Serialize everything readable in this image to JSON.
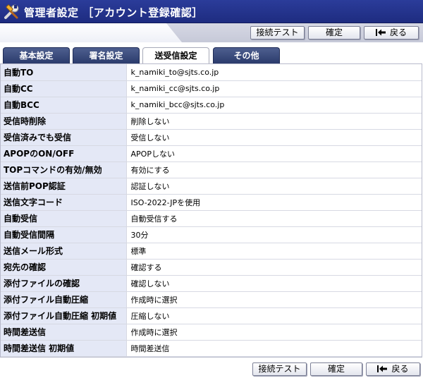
{
  "header": {
    "title": "管理者設定 ［アカウント登録確認］",
    "icon": "tools-icon"
  },
  "buttons": {
    "connection_test": "接続テスト",
    "confirm": "確定",
    "back": "戻る"
  },
  "tabs": [
    {
      "label": "基本設定",
      "active": false
    },
    {
      "label": "署名設定",
      "active": false
    },
    {
      "label": "送受信設定",
      "active": true
    },
    {
      "label": "その他",
      "active": false
    }
  ],
  "rows": [
    {
      "label": "自動TO",
      "value": "k_namiki_to@sjts.co.jp"
    },
    {
      "label": "自動CC",
      "value": "k_namiki_cc@sjts.co.jp"
    },
    {
      "label": "自動BCC",
      "value": "k_namiki_bcc@sjts.co.jp"
    },
    {
      "label": "受信時削除",
      "value": "削除しない"
    },
    {
      "label": "受信済みでも受信",
      "value": "受信しない"
    },
    {
      "label": "APOPのON/OFF",
      "value": "APOPしない"
    },
    {
      "label": "TOPコマンドの有効/無効",
      "value": "有効にする"
    },
    {
      "label": "送信前POP認証",
      "value": "認証しない"
    },
    {
      "label": "送信文字コード",
      "value": "ISO-2022-JPを使用"
    },
    {
      "label": "自動受信",
      "value": "自動受信する"
    },
    {
      "label": "自動受信間隔",
      "value": "30分"
    },
    {
      "label": "送信メール形式",
      "value": "標準"
    },
    {
      "label": "宛先の確認",
      "value": "確認する"
    },
    {
      "label": "添付ファイルの確認",
      "value": "確認しない"
    },
    {
      "label": "添付ファイル自動圧縮",
      "value": "作成時に選択"
    },
    {
      "label": "添付ファイル自動圧縮 初期値",
      "value": "圧縮しない"
    },
    {
      "label": "時間差送信",
      "value": "作成時に選択"
    },
    {
      "label": "時間差送信 初期値",
      "value": "時間差送信"
    }
  ],
  "colors": {
    "header_bg": "#1e2c80",
    "tab_bg": "#2b3b6c",
    "label_bg": "#e4e8f6"
  }
}
